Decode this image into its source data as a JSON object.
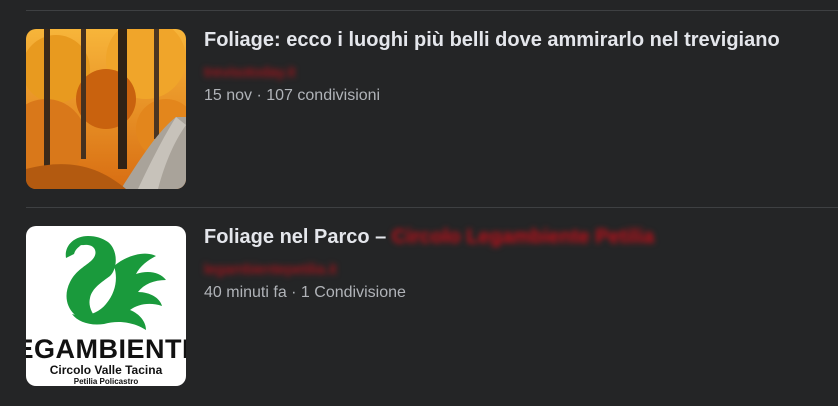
{
  "results": [
    {
      "title": "Foliage: ecco i luoghi più belli dove ammirarlo nel trevigiano",
      "source": "trevisotoday.it",
      "meta": "15 nov · 107 condivisioni"
    },
    {
      "title": "Foliage nel Parco –",
      "title_redacted": "Circolo Legambiente Petilia",
      "source": "legambientepetilia.it",
      "meta": "40 minuti fa · 1 Condivisione",
      "logo": {
        "wordmark": "EGAMBIENTE",
        "line1": "Circolo Valle Tacina",
        "line2": "Petilia Policastro"
      }
    }
  ],
  "colors": {
    "background": "#242526",
    "divider": "#3e4042",
    "title": "#e4e6eb",
    "meta": "#b0b3b8",
    "logo_green": "#1a9a3c"
  }
}
